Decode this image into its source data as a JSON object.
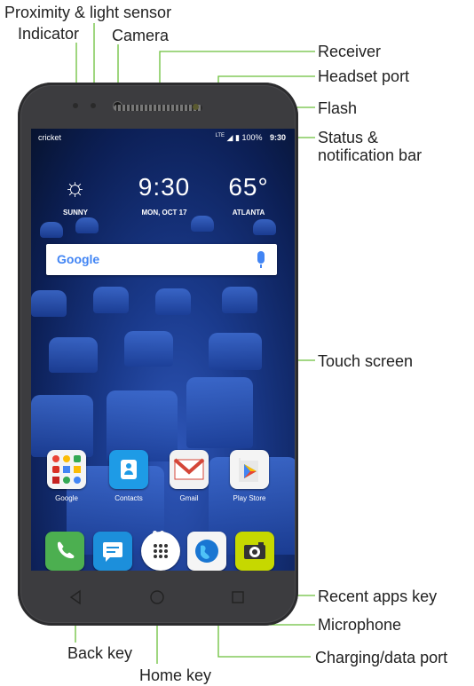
{
  "callouts": {
    "proximity": "Proximity & light sensor",
    "indicator": "Indicator",
    "camera": "Camera",
    "receiver": "Receiver",
    "headset": "Headset port",
    "flash": "Flash",
    "status": "Status &",
    "status2": "notification bar",
    "touch": "Touch screen",
    "recent": "Recent apps key",
    "microphone": "Microphone",
    "back": "Back key",
    "home": "Home key",
    "charging": "Charging/data port"
  },
  "screen": {
    "carrier": "cricket",
    "network": "LTE",
    "battery": "100%",
    "time": "9:30",
    "weather_clock": "9:30",
    "weather_temp": "65°",
    "weather_condition": "SUNNY",
    "date": "MON, OCT 17",
    "city": "ATLANTA",
    "search_logo": "Google"
  },
  "apps": [
    {
      "label": "Google",
      "icon": "google-folder-icon"
    },
    {
      "label": "Contacts",
      "icon": "contacts-icon"
    },
    {
      "label": "Gmail",
      "icon": "gmail-icon"
    },
    {
      "label": "Play Store",
      "icon": "play-store-icon"
    }
  ],
  "dock": [
    "phone-icon",
    "messaging-icon",
    "app-drawer-icon",
    "browser-icon",
    "camera-app-icon"
  ],
  "colors": {
    "leader": "#6bbf3a",
    "phone_body": "#4a4a4d",
    "wallpaper": "#1a3a8c"
  }
}
